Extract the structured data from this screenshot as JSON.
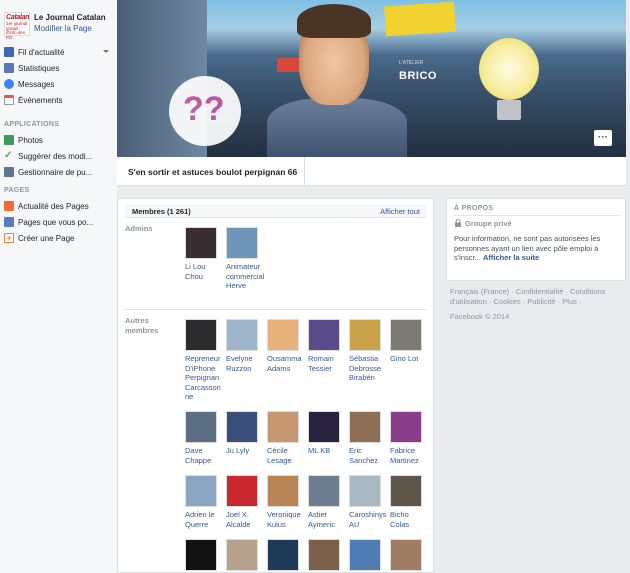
{
  "page": {
    "name": "Le Journal Catalan",
    "edit_label": "Modifier la Page",
    "logo_line1": "Catalan",
    "logo_line2": "1er journal gratuit d'info des PO"
  },
  "sidebar": {
    "nav": [
      {
        "label": "Fil d'actualité",
        "icon": "news-feed-icon",
        "color": "#4267b2"
      },
      {
        "label": "Statistiques",
        "icon": "stats-icon",
        "color": "#5e78b5"
      },
      {
        "label": "Messages",
        "icon": "messages-icon",
        "color": "#4080ff"
      },
      {
        "label": "Évènements",
        "icon": "calendar-icon",
        "color": "#e9573f"
      }
    ],
    "apps_title": "APPLICATIONS",
    "apps": [
      {
        "label": "Photos",
        "icon": "photos-icon",
        "color": "#3b9a5a"
      },
      {
        "label": "Suggérer des modi...",
        "icon": "check-icon",
        "color": "#5fa93a"
      },
      {
        "label": "Gestionnaire de pu...",
        "icon": "ads-manager-icon",
        "color": "#5f7394"
      }
    ],
    "pages_title": "PAGES",
    "pages": [
      {
        "label": "Actualité des Pages",
        "icon": "megaphone-icon",
        "color": "#f06b38"
      },
      {
        "label": "Pages que vous po...",
        "icon": "thumbs-up-icon",
        "color": "#5b7bc0"
      },
      {
        "label": "Créer une Page",
        "icon": "create-page-icon",
        "color": "#e8883a"
      }
    ]
  },
  "cover": {
    "store_sign": "BRICO",
    "store_sign_top": "L'ATELIER",
    "question_marks": "??",
    "menu_label": "···"
  },
  "tab": {
    "group_name": "S'en sortir et astuces boulot perpignan 66"
  },
  "members": {
    "title": "Membres (1 261)",
    "show_all": "Afficher tout",
    "admins_label": "Admins",
    "others_label": "Autres membres",
    "admins": [
      {
        "name": "Li Lou Chou",
        "color": "#3a2e33"
      },
      {
        "name": "Animateur commercial Herve",
        "color": "#6f95b8"
      }
    ],
    "others": [
      {
        "name": "Repreneur D'iPhone Perpignan Carcassonne",
        "color": "#2c2c2e"
      },
      {
        "name": "Evelyne Ruzzon",
        "color": "#9fb5cc"
      },
      {
        "name": "Ousamma Adams",
        "color": "#e8b07a"
      },
      {
        "name": "Romain Tessier",
        "color": "#5a4a8a"
      },
      {
        "name": "Sébastia Debrosse Birabén",
        "color": "#c9a24a"
      },
      {
        "name": "Gino Lot",
        "color": "#7d7a72"
      },
      {
        "name": "Dave Chappe",
        "color": "#5c6e84"
      },
      {
        "name": "Ju Lyly",
        "color": "#3a4f7a"
      },
      {
        "name": "Cécile Lesage",
        "color": "#c7956f"
      },
      {
        "name": "ML KB",
        "color": "#2a2340"
      },
      {
        "name": "Eric Sanchez",
        "color": "#8e6f55"
      },
      {
        "name": "Fabrice Martinez",
        "color": "#8a3d8a"
      },
      {
        "name": "Adrien le Querre",
        "color": "#8ba6c2"
      },
      {
        "name": "Joel X. Alcalde",
        "color": "#c9282e"
      },
      {
        "name": "Veronique Kulus",
        "color": "#b98555"
      },
      {
        "name": "Astier Aymeric",
        "color": "#6b7d8f"
      },
      {
        "name": "Caroshinys AU",
        "color": "#a9b9c4"
      },
      {
        "name": "Bicho Colas",
        "color": "#5f5649"
      },
      {
        "name": "",
        "color": "#111111"
      },
      {
        "name": "",
        "color": "#b5a18c"
      },
      {
        "name": "",
        "color": "#1d3b58"
      },
      {
        "name": "",
        "color": "#7a6048"
      },
      {
        "name": "",
        "color": "#4f7cb3"
      },
      {
        "name": "",
        "color": "#a07d62"
      }
    ]
  },
  "about": {
    "title": "À PROPOS",
    "privacy": "Groupe privé",
    "description": "Pour information, ne sont pas autorisées les personnes ayant un lien avec pôle emploi à s'inscr...",
    "see_more": "Afficher la suite"
  },
  "footer": {
    "links": "Français (France) · Confidentialité · Conditions d'utilisation · Cookies · Publicité · Plus ·",
    "copyright": "Facebook © 2014"
  }
}
